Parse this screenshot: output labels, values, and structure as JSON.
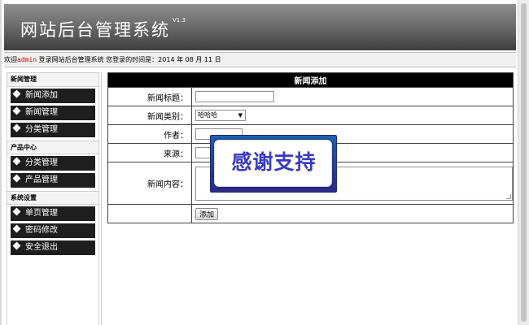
{
  "header": {
    "title": "网站后台管理系统",
    "version": "V1.3"
  },
  "welcome": {
    "prefix": "欢迎",
    "username": "admin",
    "suffix": " 登录网站后台管理系统  您登录的时间是：2014 年 08 月 11 日"
  },
  "sidebar": {
    "groups": [
      {
        "title": "新闻管理",
        "items": [
          "新闻添加",
          "新闻管理",
          "分类管理"
        ]
      },
      {
        "title": "产品中心",
        "items": [
          "分类管理",
          "产品管理"
        ]
      },
      {
        "title": "系统设置",
        "items": [
          "单页管理",
          "密码修改",
          "安全退出"
        ]
      }
    ]
  },
  "form": {
    "title": "新闻添加",
    "news_title_label": "新闻标题：",
    "news_title_value": "",
    "category_label": "新闻类别：",
    "category_selected": "哈哈哈",
    "author_label": "作者：",
    "author_value": "",
    "source_label": "来源：",
    "source_value": "",
    "content_label": "新闻内容：",
    "submit_label": "添加"
  },
  "overlay": {
    "text": "感谢支持"
  }
}
